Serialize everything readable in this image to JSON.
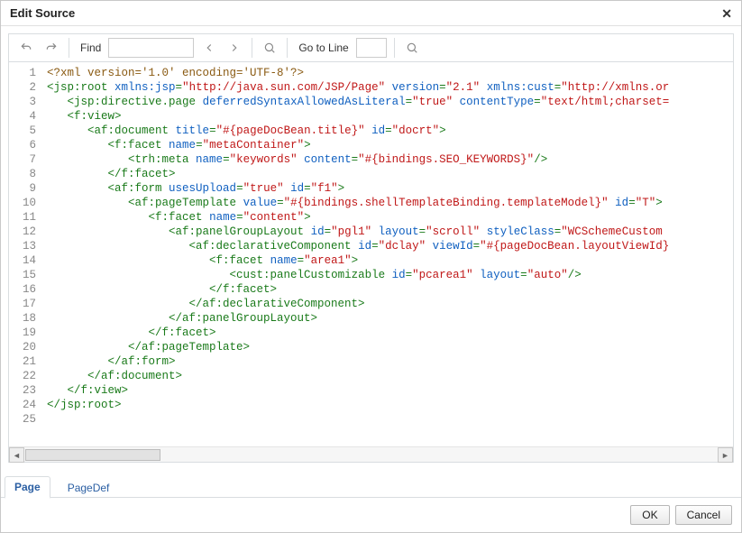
{
  "dialog": {
    "title": "Edit Source"
  },
  "toolbar": {
    "find_label": "Find",
    "find_value": "",
    "goto_label": "Go to Line",
    "goto_value": ""
  },
  "tabs": {
    "page": "Page",
    "pagedef": "PageDef",
    "active": "page"
  },
  "buttons": {
    "ok": "OK",
    "cancel": "Cancel"
  },
  "code_lines": [
    {
      "n": 1,
      "tokens": [
        {
          "c": "pi",
          "t": "<?xml version='1.0' encoding='UTF-8'?>"
        }
      ]
    },
    {
      "n": 2,
      "tokens": [
        {
          "c": "tag",
          "t": "<jsp:root"
        },
        {
          "c": "",
          "t": " "
        },
        {
          "c": "attr",
          "t": "xmlns:jsp"
        },
        {
          "c": "tag",
          "t": "="
        },
        {
          "c": "val",
          "t": "\"http://java.sun.com/JSP/Page\""
        },
        {
          "c": "",
          "t": " "
        },
        {
          "c": "attr",
          "t": "version"
        },
        {
          "c": "tag",
          "t": "="
        },
        {
          "c": "val",
          "t": "\"2.1\""
        },
        {
          "c": "",
          "t": " "
        },
        {
          "c": "attr",
          "t": "xmlns:cust"
        },
        {
          "c": "tag",
          "t": "="
        },
        {
          "c": "val",
          "t": "\"http://xmlns.or"
        }
      ]
    },
    {
      "n": 3,
      "tokens": [
        {
          "c": "",
          "t": "   "
        },
        {
          "c": "tag",
          "t": "<jsp:directive.page"
        },
        {
          "c": "",
          "t": " "
        },
        {
          "c": "attr",
          "t": "deferredSyntaxAllowedAsLiteral"
        },
        {
          "c": "tag",
          "t": "="
        },
        {
          "c": "val",
          "t": "\"true\""
        },
        {
          "c": "",
          "t": " "
        },
        {
          "c": "attr",
          "t": "contentType"
        },
        {
          "c": "tag",
          "t": "="
        },
        {
          "c": "val",
          "t": "\"text/html;charset="
        }
      ]
    },
    {
      "n": 4,
      "tokens": [
        {
          "c": "",
          "t": "   "
        },
        {
          "c": "tag",
          "t": "<f:view>"
        }
      ]
    },
    {
      "n": 5,
      "tokens": [
        {
          "c": "",
          "t": "      "
        },
        {
          "c": "tag",
          "t": "<af:document"
        },
        {
          "c": "",
          "t": " "
        },
        {
          "c": "attr",
          "t": "title"
        },
        {
          "c": "tag",
          "t": "="
        },
        {
          "c": "val",
          "t": "\"#{pageDocBean.title}\""
        },
        {
          "c": "",
          "t": " "
        },
        {
          "c": "attr",
          "t": "id"
        },
        {
          "c": "tag",
          "t": "="
        },
        {
          "c": "val",
          "t": "\"docrt\""
        },
        {
          "c": "tag",
          "t": ">"
        }
      ]
    },
    {
      "n": 6,
      "tokens": [
        {
          "c": "",
          "t": "         "
        },
        {
          "c": "tag",
          "t": "<f:facet"
        },
        {
          "c": "",
          "t": " "
        },
        {
          "c": "attr",
          "t": "name"
        },
        {
          "c": "tag",
          "t": "="
        },
        {
          "c": "val",
          "t": "\"metaContainer\""
        },
        {
          "c": "tag",
          "t": ">"
        }
      ]
    },
    {
      "n": 7,
      "tokens": [
        {
          "c": "",
          "t": "            "
        },
        {
          "c": "tag",
          "t": "<trh:meta"
        },
        {
          "c": "",
          "t": " "
        },
        {
          "c": "attr",
          "t": "name"
        },
        {
          "c": "tag",
          "t": "="
        },
        {
          "c": "val",
          "t": "\"keywords\""
        },
        {
          "c": "",
          "t": " "
        },
        {
          "c": "attr",
          "t": "content"
        },
        {
          "c": "tag",
          "t": "="
        },
        {
          "c": "val",
          "t": "\"#{bindings.SEO_KEYWORDS}\""
        },
        {
          "c": "tag",
          "t": "/>"
        }
      ]
    },
    {
      "n": 8,
      "tokens": [
        {
          "c": "",
          "t": "         "
        },
        {
          "c": "tag",
          "t": "</f:facet>"
        }
      ]
    },
    {
      "n": 9,
      "tokens": [
        {
          "c": "",
          "t": "         "
        },
        {
          "c": "tag",
          "t": "<af:form"
        },
        {
          "c": "",
          "t": " "
        },
        {
          "c": "attr",
          "t": "usesUpload"
        },
        {
          "c": "tag",
          "t": "="
        },
        {
          "c": "val",
          "t": "\"true\""
        },
        {
          "c": "",
          "t": " "
        },
        {
          "c": "attr",
          "t": "id"
        },
        {
          "c": "tag",
          "t": "="
        },
        {
          "c": "val",
          "t": "\"f1\""
        },
        {
          "c": "tag",
          "t": ">"
        }
      ]
    },
    {
      "n": 10,
      "tokens": [
        {
          "c": "",
          "t": "            "
        },
        {
          "c": "tag",
          "t": "<af:pageTemplate"
        },
        {
          "c": "",
          "t": " "
        },
        {
          "c": "attr",
          "t": "value"
        },
        {
          "c": "tag",
          "t": "="
        },
        {
          "c": "val",
          "t": "\"#{bindings.shellTemplateBinding.templateModel}\""
        },
        {
          "c": "",
          "t": " "
        },
        {
          "c": "attr",
          "t": "id"
        },
        {
          "c": "tag",
          "t": "="
        },
        {
          "c": "val",
          "t": "\"T\""
        },
        {
          "c": "tag",
          "t": ">"
        }
      ]
    },
    {
      "n": 11,
      "tokens": [
        {
          "c": "",
          "t": "               "
        },
        {
          "c": "tag",
          "t": "<f:facet"
        },
        {
          "c": "",
          "t": " "
        },
        {
          "c": "attr",
          "t": "name"
        },
        {
          "c": "tag",
          "t": "="
        },
        {
          "c": "val",
          "t": "\"content\""
        },
        {
          "c": "tag",
          "t": ">"
        }
      ]
    },
    {
      "n": 12,
      "tokens": [
        {
          "c": "",
          "t": "                  "
        },
        {
          "c": "tag",
          "t": "<af:panelGroupLayout"
        },
        {
          "c": "",
          "t": " "
        },
        {
          "c": "attr",
          "t": "id"
        },
        {
          "c": "tag",
          "t": "="
        },
        {
          "c": "val",
          "t": "\"pgl1\""
        },
        {
          "c": "",
          "t": " "
        },
        {
          "c": "attr",
          "t": "layout"
        },
        {
          "c": "tag",
          "t": "="
        },
        {
          "c": "val",
          "t": "\"scroll\""
        },
        {
          "c": "",
          "t": " "
        },
        {
          "c": "attr",
          "t": "styleClass"
        },
        {
          "c": "tag",
          "t": "="
        },
        {
          "c": "val",
          "t": "\"WCSchemeCustom"
        }
      ]
    },
    {
      "n": 13,
      "tokens": [
        {
          "c": "",
          "t": "                     "
        },
        {
          "c": "tag",
          "t": "<af:declarativeComponent"
        },
        {
          "c": "",
          "t": " "
        },
        {
          "c": "attr",
          "t": "id"
        },
        {
          "c": "tag",
          "t": "="
        },
        {
          "c": "val",
          "t": "\"dclay\""
        },
        {
          "c": "",
          "t": " "
        },
        {
          "c": "attr",
          "t": "viewId"
        },
        {
          "c": "tag",
          "t": "="
        },
        {
          "c": "val",
          "t": "\"#{pageDocBean.layoutViewId}"
        }
      ]
    },
    {
      "n": 14,
      "tokens": [
        {
          "c": "",
          "t": "                        "
        },
        {
          "c": "tag",
          "t": "<f:facet"
        },
        {
          "c": "",
          "t": " "
        },
        {
          "c": "attr",
          "t": "name"
        },
        {
          "c": "tag",
          "t": "="
        },
        {
          "c": "val",
          "t": "\"area1\""
        },
        {
          "c": "tag",
          "t": ">"
        }
      ]
    },
    {
      "n": 15,
      "tokens": [
        {
          "c": "",
          "t": "                           "
        },
        {
          "c": "tag",
          "t": "<cust:panelCustomizable"
        },
        {
          "c": "",
          "t": " "
        },
        {
          "c": "attr",
          "t": "id"
        },
        {
          "c": "tag",
          "t": "="
        },
        {
          "c": "val",
          "t": "\"pcarea1\""
        },
        {
          "c": "",
          "t": " "
        },
        {
          "c": "attr",
          "t": "layout"
        },
        {
          "c": "tag",
          "t": "="
        },
        {
          "c": "val",
          "t": "\"auto\""
        },
        {
          "c": "tag",
          "t": "/>"
        }
      ]
    },
    {
      "n": 16,
      "tokens": [
        {
          "c": "",
          "t": "                        "
        },
        {
          "c": "tag",
          "t": "</f:facet>"
        }
      ]
    },
    {
      "n": 17,
      "tokens": [
        {
          "c": "",
          "t": "                     "
        },
        {
          "c": "tag",
          "t": "</af:declarativeComponent>"
        }
      ]
    },
    {
      "n": 18,
      "tokens": [
        {
          "c": "",
          "t": "                  "
        },
        {
          "c": "tag",
          "t": "</af:panelGroupLayout>"
        }
      ]
    },
    {
      "n": 19,
      "tokens": [
        {
          "c": "",
          "t": "               "
        },
        {
          "c": "tag",
          "t": "</f:facet>"
        }
      ]
    },
    {
      "n": 20,
      "tokens": [
        {
          "c": "",
          "t": "            "
        },
        {
          "c": "tag",
          "t": "</af:pageTemplate>"
        }
      ]
    },
    {
      "n": 21,
      "tokens": [
        {
          "c": "",
          "t": "         "
        },
        {
          "c": "tag",
          "t": "</af:form>"
        }
      ]
    },
    {
      "n": 22,
      "tokens": [
        {
          "c": "",
          "t": "      "
        },
        {
          "c": "tag",
          "t": "</af:document>"
        }
      ]
    },
    {
      "n": 23,
      "tokens": [
        {
          "c": "",
          "t": "   "
        },
        {
          "c": "tag",
          "t": "</f:view>"
        }
      ]
    },
    {
      "n": 24,
      "tokens": [
        {
          "c": "tag",
          "t": "</jsp:root>"
        }
      ]
    },
    {
      "n": 25,
      "tokens": []
    }
  ]
}
